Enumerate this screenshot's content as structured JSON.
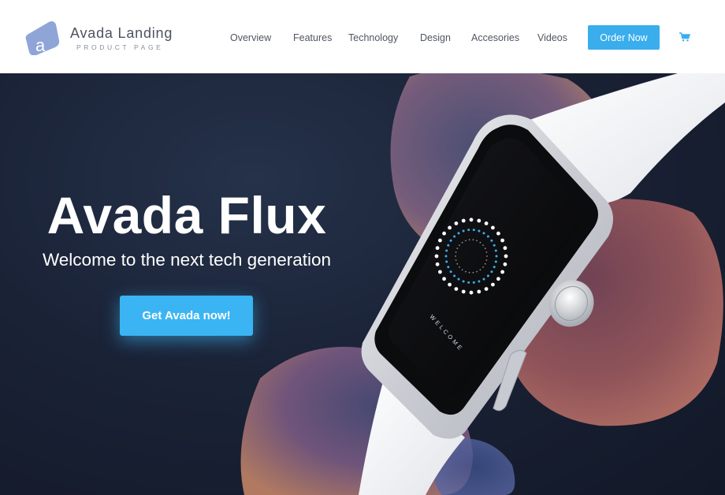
{
  "brand": {
    "title": "Avada Landing",
    "subtitle": "PRODUCT PAGE",
    "logo_letter": "a",
    "icon": "avada-logo-icon",
    "logo_color": "#8fa5d7"
  },
  "nav": {
    "items": [
      {
        "label": "Overview"
      },
      {
        "label": "Features"
      },
      {
        "label": "Technology"
      },
      {
        "label": "Design"
      },
      {
        "label": "Accesories"
      },
      {
        "label": "Videos"
      }
    ],
    "order_button": "Order Now",
    "cart_icon": "shopping-cart-icon"
  },
  "hero": {
    "title": "Avada Flux",
    "subtitle": "Welcome to the next tech generation",
    "cta_label": "Get Avada now!",
    "watch_screen_text": "WELCOME"
  },
  "colors": {
    "accent": "#3aaeed",
    "hero_background": "#1a2236",
    "nav_text": "#505664"
  }
}
